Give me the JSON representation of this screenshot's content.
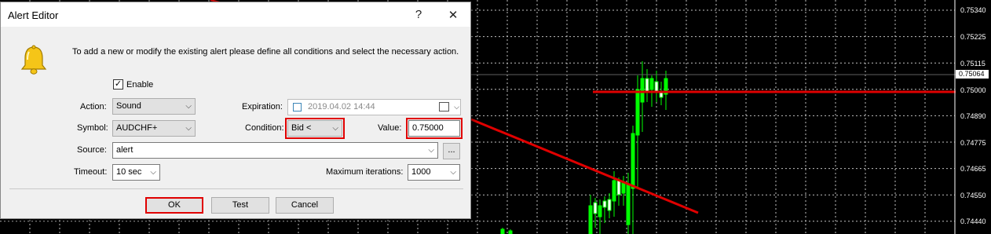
{
  "chart": {
    "price_labels": [
      "0.75340",
      "0.75225",
      "0.75115",
      "0.75000",
      "0.74890",
      "0.74775",
      "0.74665",
      "0.74550",
      "0.74440"
    ],
    "current_price": "0.75064"
  },
  "dialog": {
    "title": "Alert Editor",
    "help_symbol": "?",
    "close_symbol": "✕",
    "info_text": "To add a new or modify the existing alert please define all conditions and select the necessary action.",
    "enable_label": "Enable",
    "enable_checked": "✓",
    "action_label": "Action:",
    "action_value": "Sound",
    "expiration_label": "Expiration:",
    "expiration_value": "2019.04.02 14:44",
    "symbol_label": "Symbol:",
    "symbol_value": "AUDCHF+",
    "condition_label": "Condition:",
    "condition_value": "Bid <",
    "value_label": "Value:",
    "value_value": "0.75000",
    "source_label": "Source:",
    "source_value": "alert",
    "browse_label": "...",
    "timeout_label": "Timeout:",
    "timeout_value": "10 sec",
    "max_iter_label": "Maximum iterations:",
    "max_iter_value": "1000",
    "ok_label": "OK",
    "test_label": "Test",
    "cancel_label": "Cancel",
    "dropdown_arrow": "⌵"
  },
  "colors": {
    "chart_bg": "#000000",
    "grid": "#c0c0c0",
    "candle": "#00ff00",
    "trend_line": "#e00000",
    "highlight": "#e00000"
  }
}
